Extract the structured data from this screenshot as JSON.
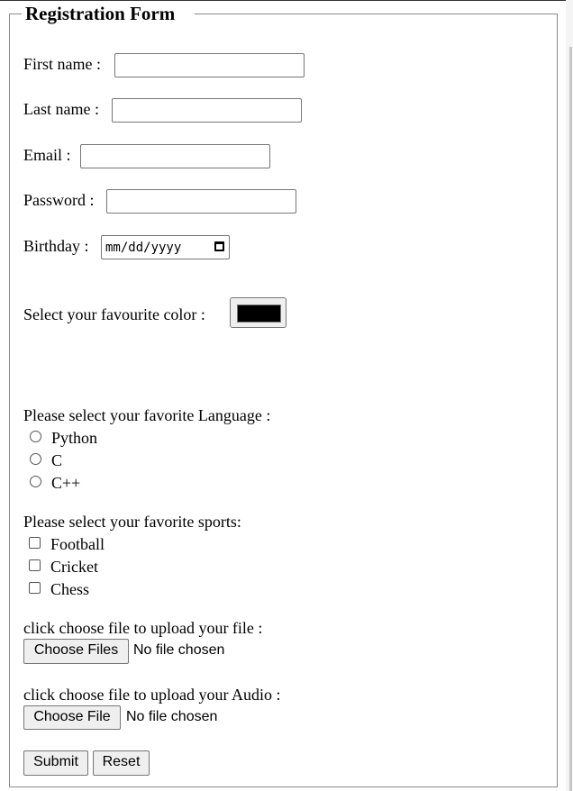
{
  "legend": "Registration Form",
  "fields": {
    "first_name": "First name :",
    "last_name": "Last name :",
    "email": "Email :",
    "password": "Password :",
    "birthday": "Birthday :",
    "birthday_placeholder": "mm/dd/yyyy",
    "color": "Select your favourite color :",
    "color_value": "#000000"
  },
  "language": {
    "label": "Please select your favorite Language :",
    "options": [
      "Python",
      "C",
      "C++"
    ]
  },
  "sports": {
    "label": "Please select your favorite sports:",
    "options": [
      "Football",
      "Cricket",
      "Chess"
    ]
  },
  "file_upload": {
    "label": "click choose file to upload your file :",
    "button": "Choose Files",
    "status": "No file chosen"
  },
  "audio_upload": {
    "label": "click choose file to upload your Audio :",
    "button": "Choose File",
    "status": "No file chosen"
  },
  "buttons": {
    "submit": "Submit",
    "reset": "Reset"
  }
}
